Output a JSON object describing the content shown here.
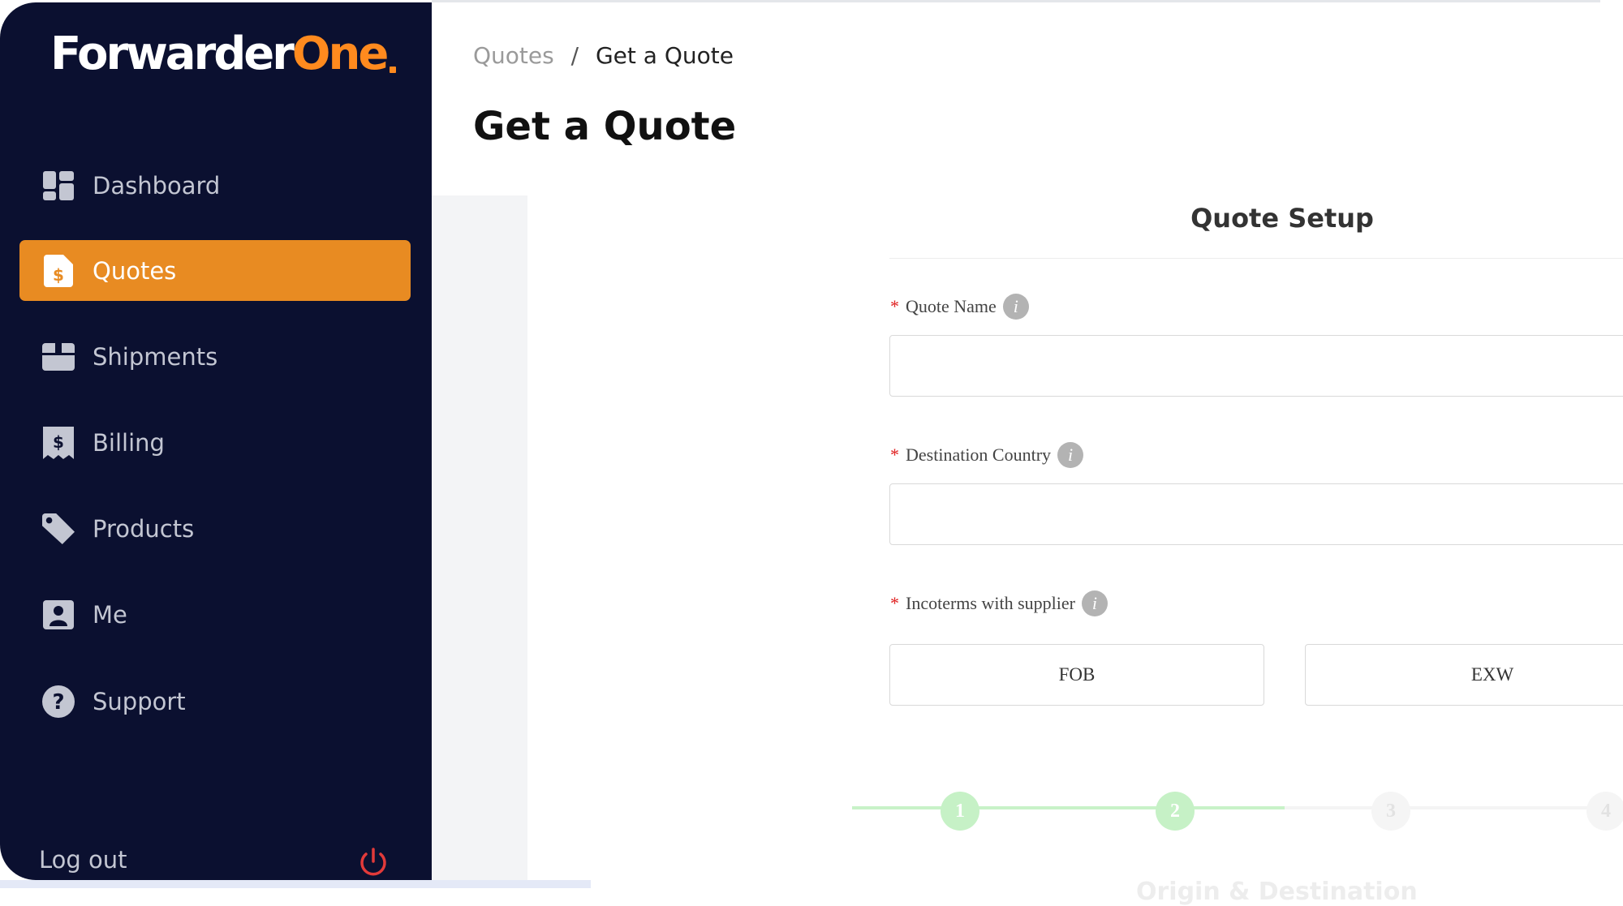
{
  "brand": {
    "logo_part1": "Forwarder",
    "logo_part2": "One",
    "accent": "#e88b22",
    "sidebar_bg": "#0b1030"
  },
  "sidebar": {
    "items": [
      {
        "label": "Dashboard",
        "icon": "dashboard-icon"
      },
      {
        "label": "Quotes",
        "icon": "quote-document-icon",
        "active": true
      },
      {
        "label": "Shipments",
        "icon": "box-icon"
      },
      {
        "label": "Billing",
        "icon": "receipt-icon"
      },
      {
        "label": "Products",
        "icon": "tag-icon"
      },
      {
        "label": "Me",
        "icon": "user-card-icon"
      },
      {
        "label": "Support",
        "icon": "question-icon"
      }
    ],
    "logout_label": "Log out"
  },
  "breadcrumb": {
    "parent": "Quotes",
    "separator": "/",
    "current": "Get a Quote"
  },
  "page_title": "Get a Quote",
  "form": {
    "title": "Quote Setup",
    "fields": [
      {
        "label": "Quote Name",
        "required_mark": "*",
        "value": ""
      },
      {
        "label": "Destination Country",
        "required_mark": "*",
        "value": ""
      }
    ],
    "incoterms": {
      "label": "Incoterms with supplier",
      "required_mark": "*",
      "options": [
        "FOB",
        "EXW"
      ]
    }
  },
  "stepper": {
    "steps": [
      "1",
      "2",
      "3",
      "4"
    ],
    "completed": 2,
    "caption": "Origin & Destination"
  }
}
